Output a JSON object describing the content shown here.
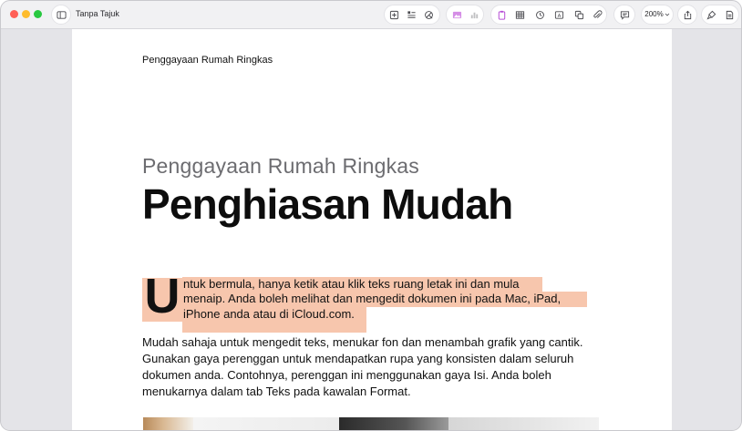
{
  "window": {
    "title": "Tanpa Tajuk"
  },
  "toolbar": {
    "zoom_label": "200%"
  },
  "document": {
    "header_text": "Penggayaan Rumah Ringkas",
    "subtitle": "Penggayaan Rumah Ringkas",
    "title": "Penghiasan Mudah",
    "drop_cap": "U",
    "para1_lines": [
      "ntuk bermula, hanya ketik atau klik teks ruang letak ini dan mula",
      "menaip. Anda boleh melihat dan mengedit dokumen ini pada Mac, iPad,",
      "iPhone anda atau di iCloud.com."
    ],
    "para2": "Mudah sahaja untuk mengedit teks, menukar fon dan menambah grafik yang cantik. Gunakan gaya perenggan untuk mendapatkan rupa yang konsisten dalam seluruh dokumen anda. Contohnya, perenggan ini menggunakan gaya Isi. Anda boleh menukarnya dalam tab Teks pada kawalan Format."
  },
  "colors": {
    "highlight": "#f7c6ad",
    "close": "#ff5f57",
    "minimize": "#febc2e",
    "zoom": "#28c840"
  },
  "icons": {
    "sidebar": "sidebar-icon",
    "insert": "plus-square-icon",
    "text_style": "text-format-icon",
    "shapes": "shape-icon",
    "media": "image-icon",
    "chart": "chart-icon",
    "table": "table-icon",
    "clock": "clock-icon",
    "text_box": "text-box-icon",
    "duplicate": "duplicate-icon",
    "attach": "paperclip-icon",
    "comment": "comment-icon",
    "share": "share-icon",
    "format": "format-brush-icon",
    "document": "document-icon"
  }
}
